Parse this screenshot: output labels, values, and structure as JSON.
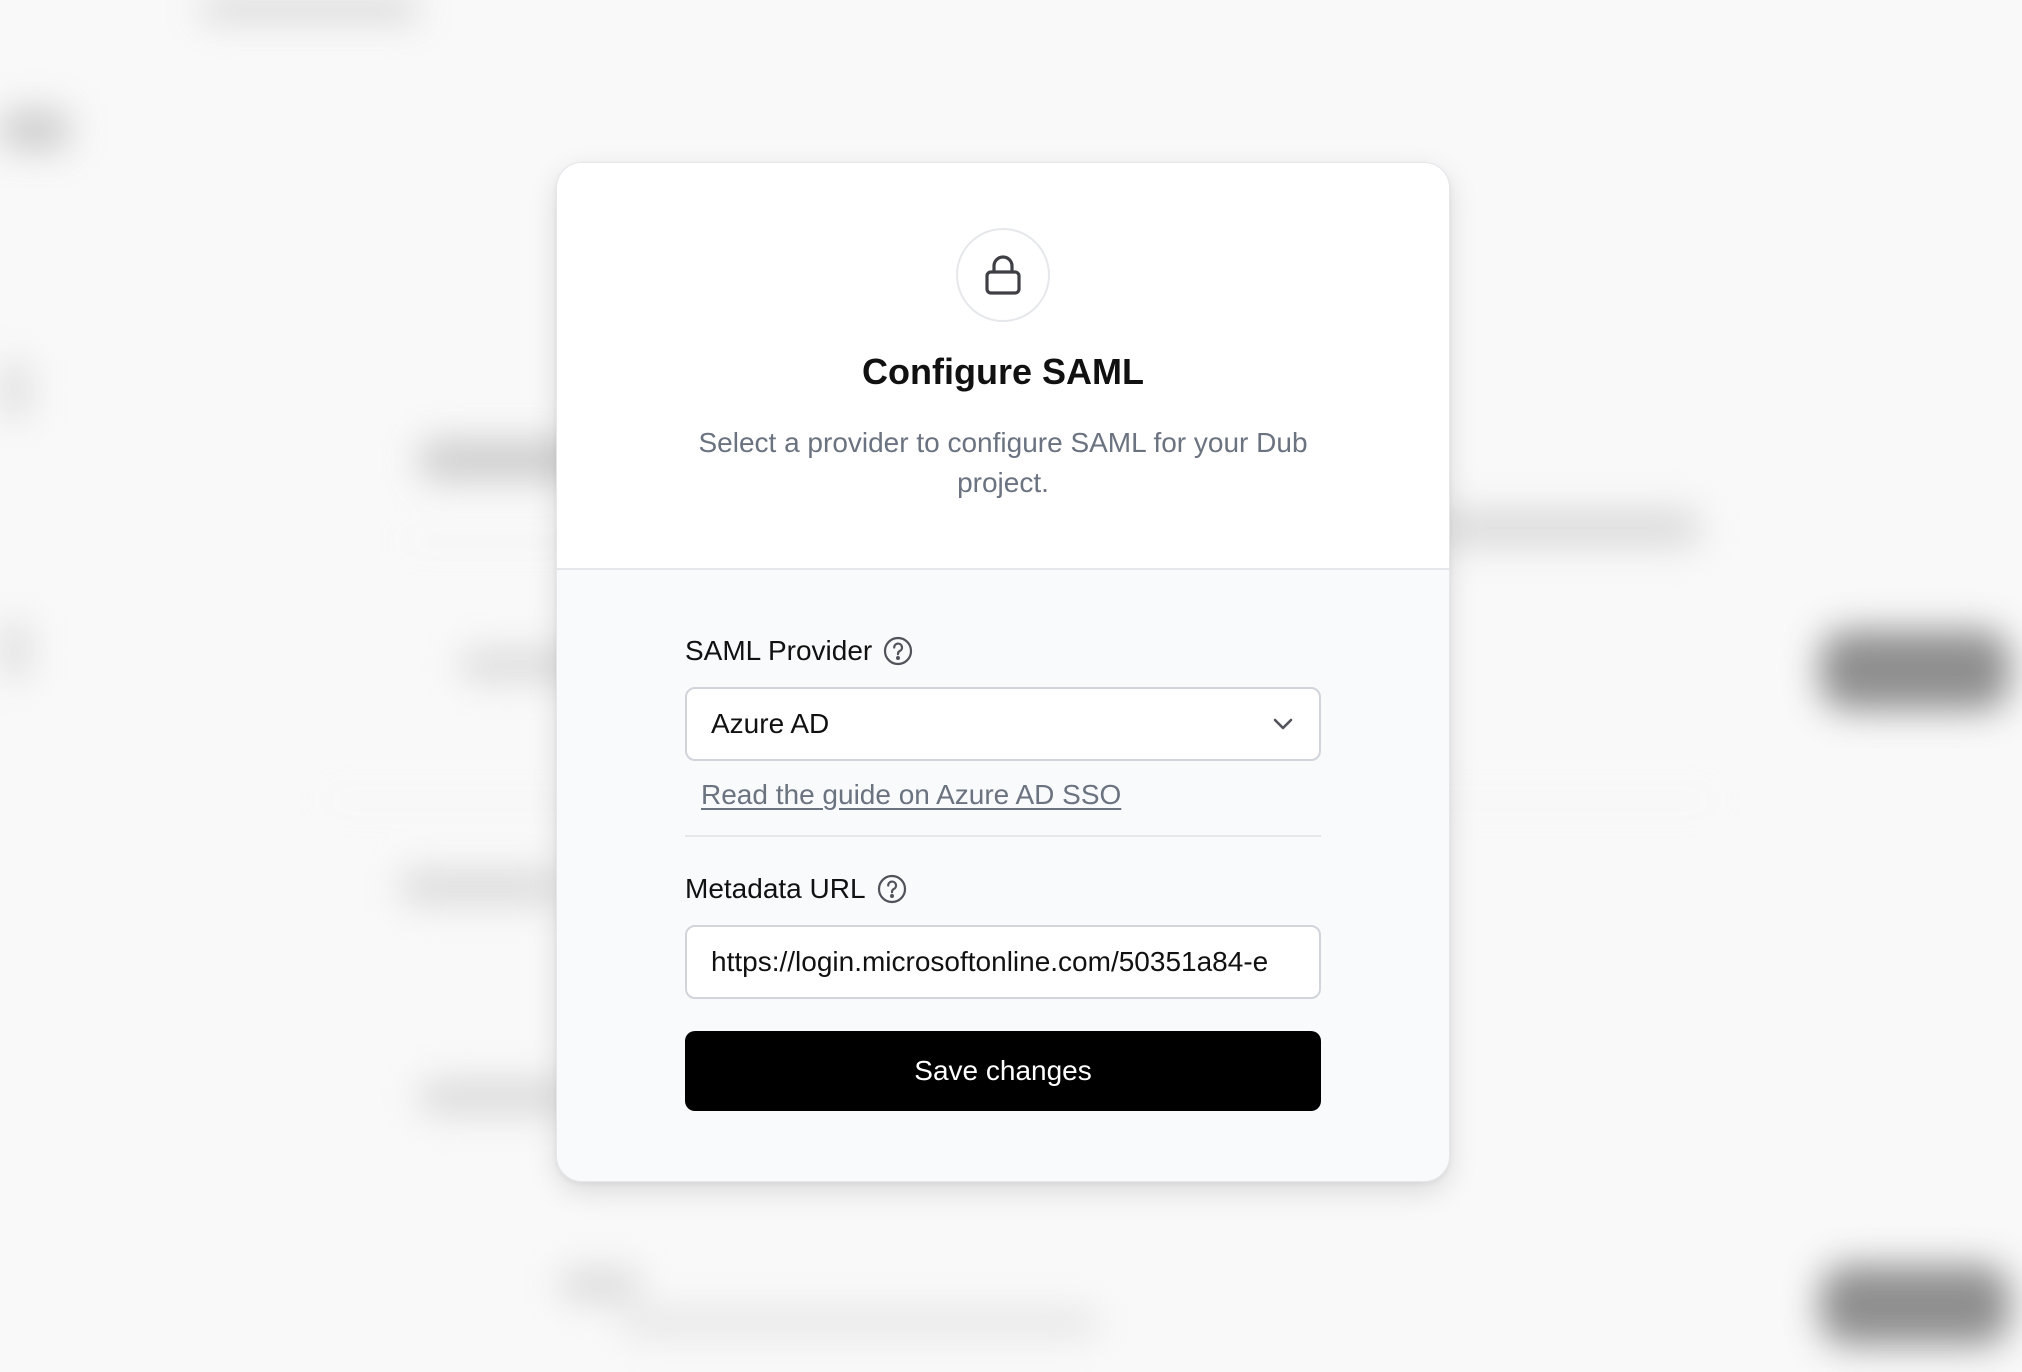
{
  "modal": {
    "title": "Configure SAML",
    "subtitle": "Select a provider to configure SAML for your Dub project.",
    "icon": "lock-icon"
  },
  "form": {
    "provider": {
      "label": "SAML Provider",
      "help_icon": "question-circle-icon",
      "selected": "Azure AD",
      "chevron_icon": "chevron-down-icon"
    },
    "guide_link": "Read the guide on Azure AD SSO",
    "metadata": {
      "label": "Metadata URL",
      "help_icon": "question-circle-icon",
      "value": "https://login.microsoftonline.com/50351a84-e"
    },
    "save_label": "Save changes"
  },
  "colors": {
    "button_bg": "#000000",
    "muted_text": "#6b7280",
    "border": "#d1d5db"
  }
}
